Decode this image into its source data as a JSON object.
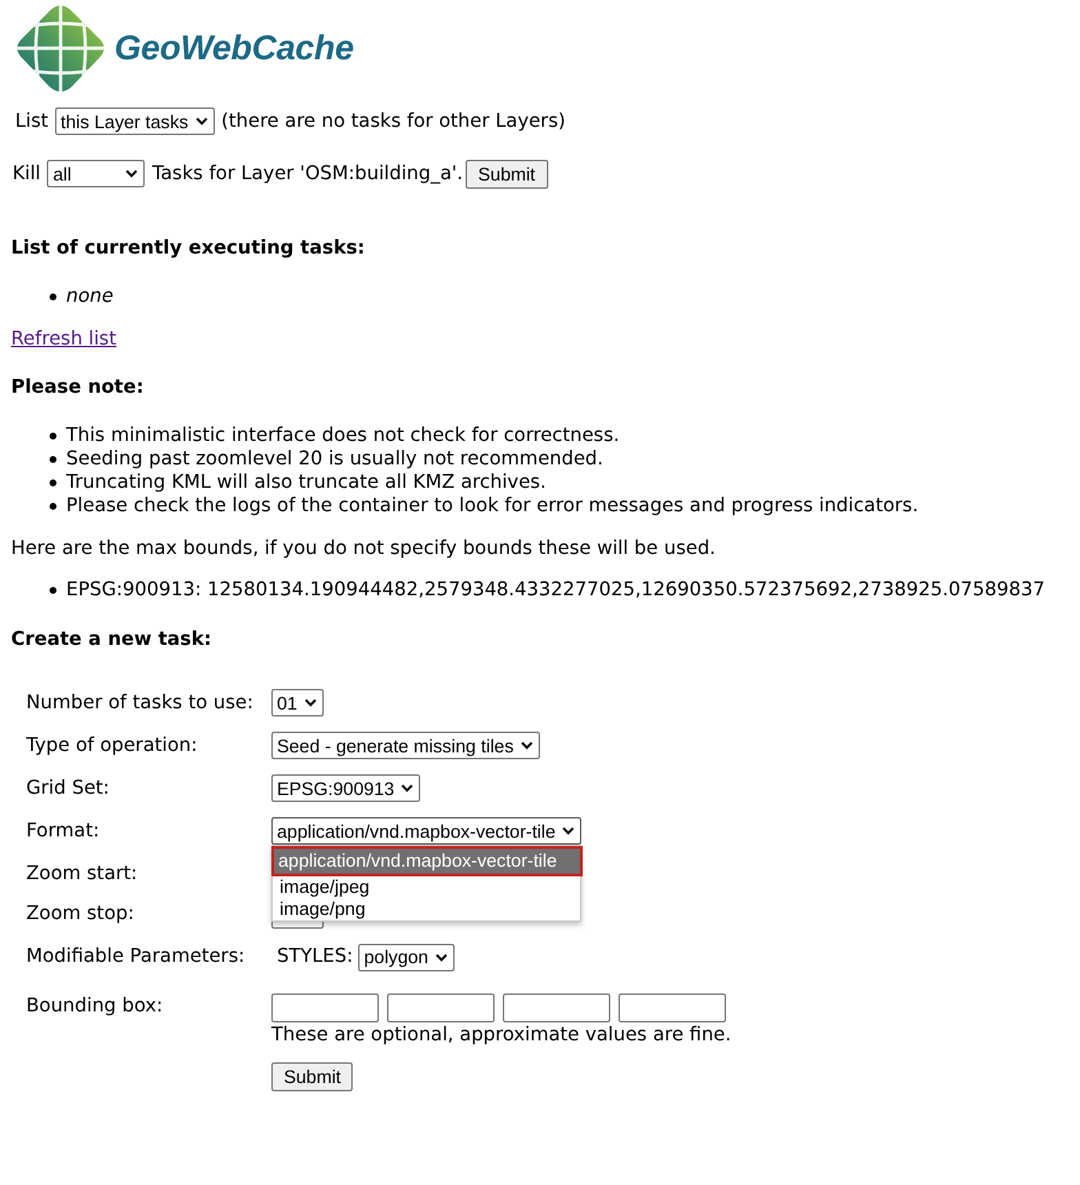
{
  "logo": {
    "text": "GeoWebCache"
  },
  "list_filter": {
    "label": "List",
    "select": {
      "value": "this Layer tasks"
    },
    "note": "(there are no tasks for other Layers)"
  },
  "kill_form": {
    "label": "Kill",
    "select": {
      "value": "all"
    },
    "text": "Tasks for Layer 'OSM:building_a'.",
    "button": "Submit"
  },
  "executing_tasks": {
    "heading": "List of currently executing tasks:",
    "items": [
      "none"
    ]
  },
  "refresh_link": "Refresh list",
  "notes": {
    "heading": "Please note:",
    "items": [
      "This minimalistic interface does not check for correctness.",
      "Seeding past zoomlevel 20 is usually not recommended.",
      "Truncating KML will also truncate all KMZ archives.",
      "Please check the logs of the container to look for error messages and progress indicators."
    ]
  },
  "bounds": {
    "intro": "Here are the max bounds, if you do not specify bounds these will be used.",
    "items": [
      "EPSG:900913: 12580134.190944482,2579348.4332277025,12690350.572375692,2738925.07589837"
    ]
  },
  "create_task": {
    "heading": "Create a new task:",
    "rows": [
      {
        "kind": "select",
        "label": "Number of tasks to use:",
        "value": "01"
      },
      {
        "kind": "select",
        "label": "Type of operation:",
        "value": "Seed - generate missing tiles"
      },
      {
        "kind": "select",
        "label": "Grid Set:",
        "value": "EPSG:900913"
      },
      {
        "kind": "select",
        "label": "Format:",
        "value": "application/vnd.mapbox-vector-tile",
        "expanded": true,
        "options": [
          {
            "label": "application/vnd.mapbox-vector-tile",
            "selected": true
          },
          {
            "label": "image/jpeg",
            "selected": false
          },
          {
            "label": "image/png",
            "selected": false
          }
        ]
      },
      {
        "kind": "covered",
        "label": "Zoom start:"
      },
      {
        "kind": "select",
        "label": "Zoom stop:"
      },
      {
        "kind": "parameters",
        "label": "Modifiable Parameters:",
        "param_label": "STYLES:",
        "value": "polygon"
      },
      {
        "kind": "bbox",
        "label": "Bounding box:",
        "fields": [
          {
            "kind": "text"
          },
          {
            "kind": "text"
          },
          {
            "kind": "text"
          },
          {
            "kind": "text"
          }
        ],
        "note": "These are optional, approximate values are fine."
      }
    ],
    "button": "Submit"
  }
}
